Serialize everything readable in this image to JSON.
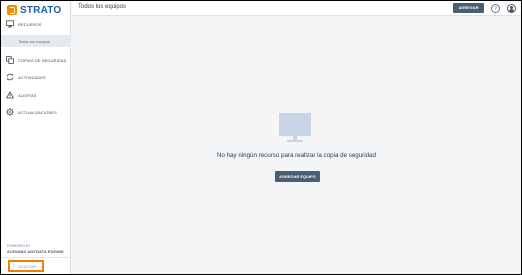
{
  "brand": {
    "name": "STRATO",
    "accent": "#f28c00",
    "text_color": "#1f5fa6"
  },
  "header": {
    "title": "Todos los equipos",
    "add_button": "AGREGAR",
    "help_icon": "question-circle-icon",
    "account_icon": "user-circle-icon"
  },
  "sidebar": {
    "items": [
      {
        "label": "RECURSOS",
        "icon": "monitor-icon"
      },
      {
        "label": "COPIAS DE SEGURIDAD",
        "icon": "copies-icon"
      },
      {
        "label": "ACTIVIDADES",
        "icon": "sync-icon"
      },
      {
        "label": "ALERTAS",
        "icon": "alert-icon"
      },
      {
        "label": "ACTUALIZACIONES",
        "icon": "gear-icon"
      }
    ],
    "subitem": "Todos los equipos",
    "powered_by": "POWERED BY",
    "engine": "ACRONIS ANYDATA ENGINE",
    "collapse_label": "OCULTAR"
  },
  "main": {
    "empty_icon": "monitor-icon",
    "empty_message": "No hay ningún recurso para realizar la copia de seguridad",
    "add_device_button": "AGREGAR EQUIPO"
  }
}
